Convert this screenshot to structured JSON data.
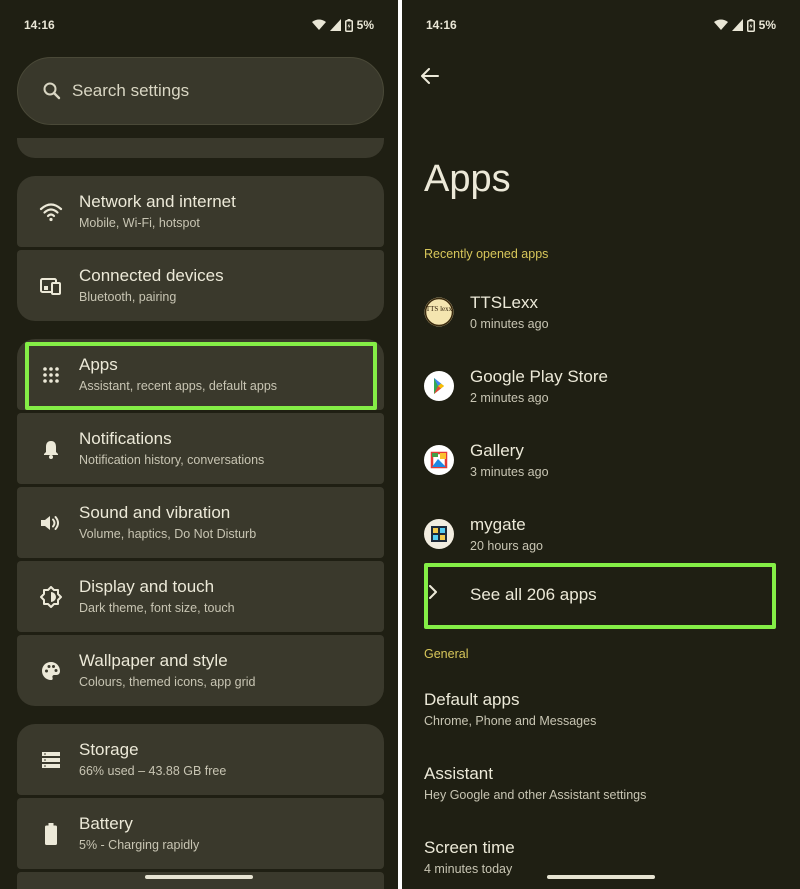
{
  "left": {
    "status": {
      "time": "14:16",
      "battery": "5%"
    },
    "search": {
      "placeholder": "Search settings",
      "icon": "search-icon"
    },
    "items": [
      {
        "title": "Network and internet",
        "subtitle": "Mobile, Wi-Fi, hotspot",
        "icon": "wifi-icon"
      },
      {
        "title": "Connected devices",
        "subtitle": "Bluetooth, pairing",
        "icon": "connected-devices-icon"
      },
      {
        "title": "Apps",
        "subtitle": "Assistant, recent apps, default apps",
        "icon": "apps-grid-icon"
      },
      {
        "title": "Notifications",
        "subtitle": "Notification history, conversations",
        "icon": "bell-icon"
      },
      {
        "title": "Sound and vibration",
        "subtitle": "Volume, haptics, Do Not Disturb",
        "icon": "speaker-icon"
      },
      {
        "title": "Display and touch",
        "subtitle": "Dark theme, font size, touch",
        "icon": "brightness-icon"
      },
      {
        "title": "Wallpaper and style",
        "subtitle": "Colours, themed icons, app grid",
        "icon": "palette-icon"
      },
      {
        "title": "Storage",
        "subtitle": "66% used – 43.88 GB free",
        "icon": "storage-icon"
      },
      {
        "title": "Battery",
        "subtitle": "5% - Charging rapidly",
        "icon": "battery-icon"
      }
    ]
  },
  "right": {
    "status": {
      "time": "14:16",
      "battery": "5%"
    },
    "title": "Apps",
    "recent_header": "Recently opened apps",
    "apps": [
      {
        "name": "TTSLexx",
        "time": "0 minutes ago",
        "icon": "ttslexx-icon"
      },
      {
        "name": "Google Play Store",
        "time": "2 minutes ago",
        "icon": "play-store-icon"
      },
      {
        "name": "Gallery",
        "time": "3 minutes ago",
        "icon": "gallery-icon"
      },
      {
        "name": "mygate",
        "time": "20 hours ago",
        "icon": "mygate-icon"
      }
    ],
    "see_all": "See all 206 apps",
    "general_header": "General",
    "general_items": [
      {
        "title": "Default apps",
        "subtitle": "Chrome, Phone and Messages"
      },
      {
        "title": "Assistant",
        "subtitle": "Hey Google and other Assistant settings"
      },
      {
        "title": "Screen time",
        "subtitle": "4 minutes today"
      }
    ],
    "ttslexx_logo_text": "TTS lexx"
  },
  "colors": {
    "background": "#1f1f13",
    "card": "#3a392c",
    "highlight": "#84ee46",
    "section_header": "#d7c65a"
  }
}
